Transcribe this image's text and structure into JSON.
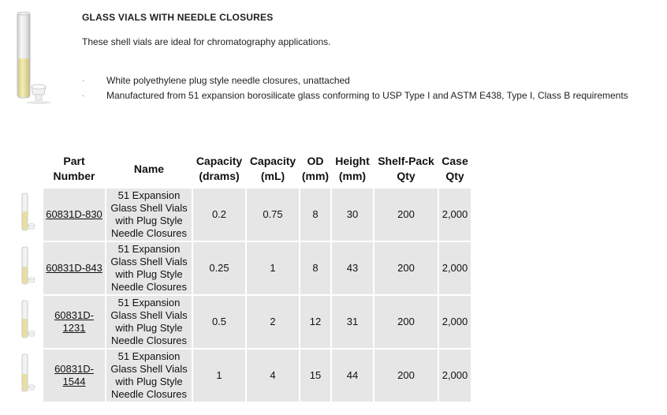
{
  "header": {
    "title": "GLASS VIALS WITH NEEDLE CLOSURES",
    "intro": "These shell vials are ideal for chromatography applications."
  },
  "bullets": [
    "White polyethylene plug style needle closures, unattached",
    "Manufactured from 51 expansion borosilicate glass conforming to USP Type I and ASTM E438, Type I, Class B requirements"
  ],
  "bullet_symbol": "·",
  "table": {
    "headers": {
      "part_number": [
        "Part",
        "Number"
      ],
      "name": "Name",
      "capacity_drams": [
        "Capacity",
        "(drams)"
      ],
      "capacity_ml": [
        "Capacity",
        "(mL)"
      ],
      "od": [
        "OD",
        "(mm)"
      ],
      "height": [
        "Height",
        "(mm)"
      ],
      "shelf_pack": [
        "Shelf-Pack",
        "Qty"
      ],
      "case": [
        "Case",
        "Qty"
      ]
    },
    "rows": [
      {
        "part": "60831D-830",
        "name": [
          "51  Expansion",
          "Glass Shell Vials",
          "with Plug Style",
          "Needle Closures"
        ],
        "drams": "0.2",
        "ml": "0.75",
        "od": "8",
        "height": "30",
        "shelf": "200",
        "case": "2,000"
      },
      {
        "part": "60831D-843",
        "name": [
          "51  Expansion",
          "Glass Shell Vials",
          "with Plug Style",
          "Needle Closures"
        ],
        "drams": "0.25",
        "ml": "1",
        "od": "8",
        "height": "43",
        "shelf": "200",
        "case": "2,000"
      },
      {
        "part": "60831D-1231",
        "name": [
          "51  Expansion",
          "Glass Shell Vials",
          "with Plug Style",
          "Needle Closures"
        ],
        "drams": "0.5",
        "ml": "2",
        "od": "12",
        "height": "31",
        "shelf": "200",
        "case": "2,000"
      },
      {
        "part": "60831D-1544",
        "name": [
          "51  Expansion",
          "Glass Shell Vials",
          "with Plug Style",
          "Needle Closures"
        ],
        "drams": "1",
        "ml": "4",
        "od": "15",
        "height": "44",
        "shelf": "200",
        "case": "2,000"
      }
    ]
  },
  "colors": {
    "cell_background": "#e6e6e6",
    "liquid": "#ece4a4",
    "text": "#222222"
  }
}
